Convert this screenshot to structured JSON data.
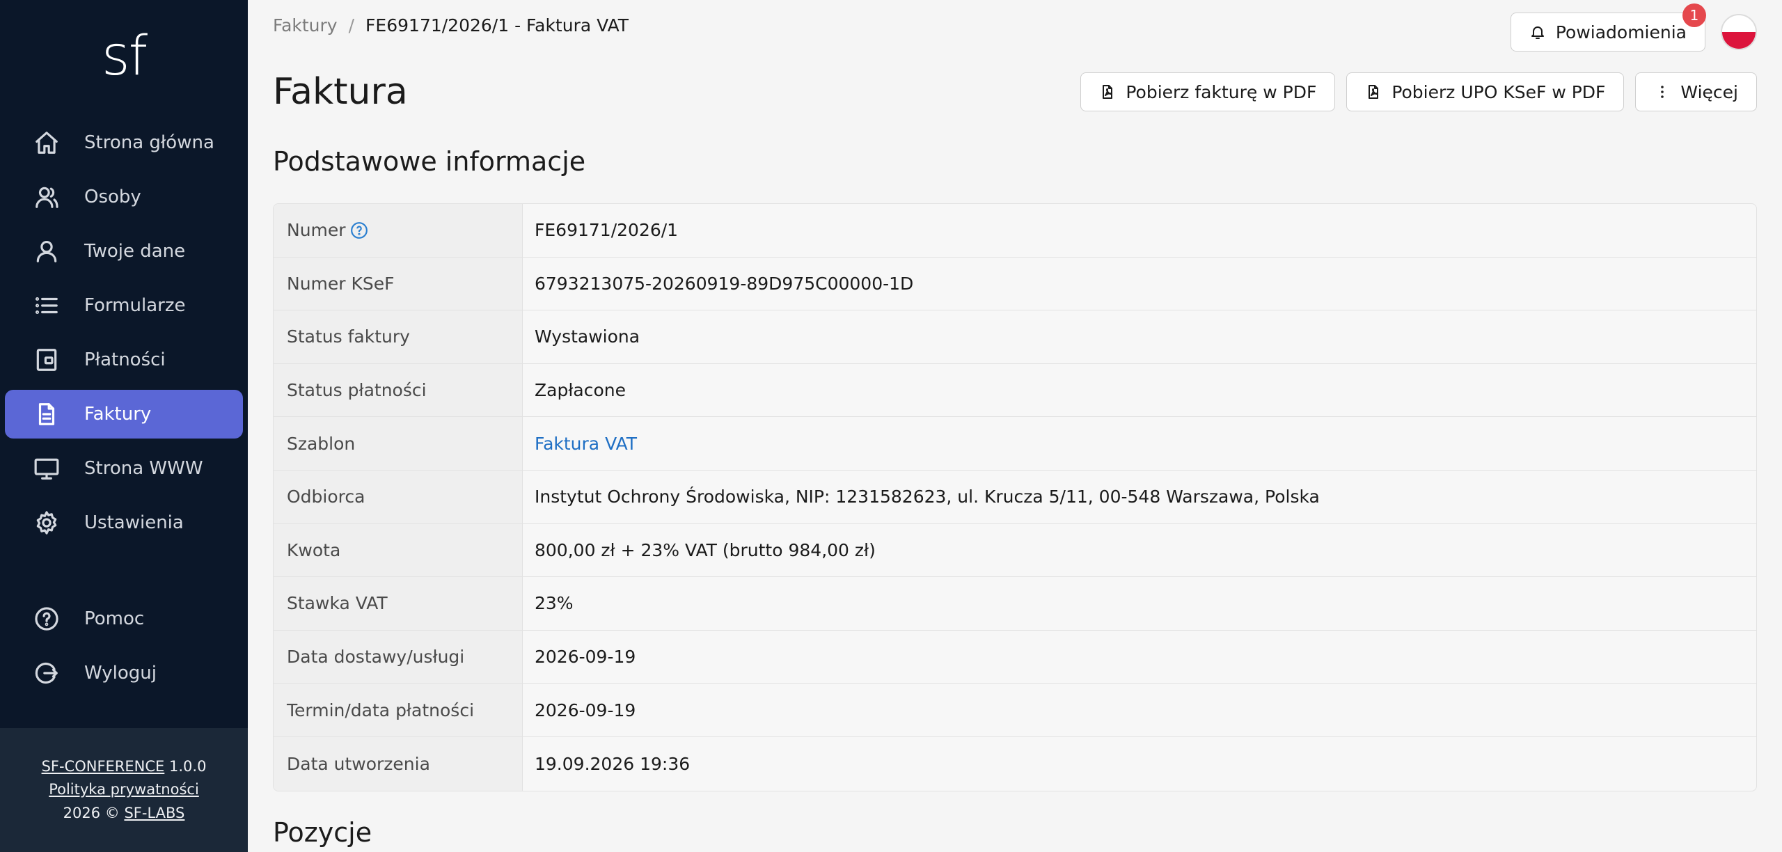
{
  "sidebar": {
    "logo": "sf",
    "items": [
      {
        "label": "Strona główna",
        "icon": "home-icon"
      },
      {
        "label": "Osoby",
        "icon": "people-icon"
      },
      {
        "label": "Twoje dane",
        "icon": "user-icon"
      },
      {
        "label": "Formularze",
        "icon": "list-icon"
      },
      {
        "label": "Płatności",
        "icon": "wallet-icon"
      },
      {
        "label": "Faktury",
        "icon": "document-icon",
        "active": true
      },
      {
        "label": "Strona WWW",
        "icon": "monitor-icon"
      },
      {
        "label": "Ustawienia",
        "icon": "gear-icon"
      }
    ],
    "bottom_items": [
      {
        "label": "Pomoc",
        "icon": "help-icon"
      },
      {
        "label": "Wyloguj",
        "icon": "logout-icon"
      }
    ],
    "footer": {
      "app_name": "SF-CONFERENCE",
      "version": "1.0.0",
      "privacy": "Polityka prywatności",
      "copyright": "2026 ©",
      "company": "SF-LABS"
    }
  },
  "header": {
    "breadcrumb": {
      "parent": "Faktury",
      "separator": "/",
      "current": "FE69171/2026/1 - Faktura VAT"
    },
    "notifications_label": "Powiadomienia",
    "notifications_count": "1"
  },
  "page": {
    "title": "Faktura",
    "actions": {
      "pdf_invoice": "Pobierz fakturę w PDF",
      "pdf_upo": "Pobierz UPO KSeF w PDF",
      "more": "Więcej"
    },
    "section_basic": "Podstawowe informacje",
    "section_items": "Pozycje"
  },
  "details": [
    {
      "label": "Numer",
      "value": "FE69171/2026/1",
      "help": true
    },
    {
      "label": "Numer KSeF",
      "value": "6793213075-20260919-89D975C00000-1D"
    },
    {
      "label": "Status faktury",
      "value": "Wystawiona"
    },
    {
      "label": "Status płatności",
      "value": "Zapłacone"
    },
    {
      "label": "Szablon",
      "value": "Faktura VAT",
      "link": true
    },
    {
      "label": "Odbiorca",
      "value": "Instytut Ochrony Środowiska, NIP: 1231582623, ul. Krucza 5/11, 00-548 Warszawa, Polska"
    },
    {
      "label": "Kwota",
      "value": "800,00 zł + 23% VAT (brutto 984,00 zł)"
    },
    {
      "label": "Stawka VAT",
      "value": "23%"
    },
    {
      "label": "Data dostawy/usługi",
      "value": "2026-09-19"
    },
    {
      "label": "Termin/data płatności",
      "value": "2026-09-19"
    },
    {
      "label": "Data utworzenia",
      "value": "19.09.2026 19:36"
    }
  ],
  "colors": {
    "sidebar_bg": "#0b1729",
    "active_item": "#5b67d6",
    "link": "#1f6fc4",
    "badge": "#e5484d"
  }
}
